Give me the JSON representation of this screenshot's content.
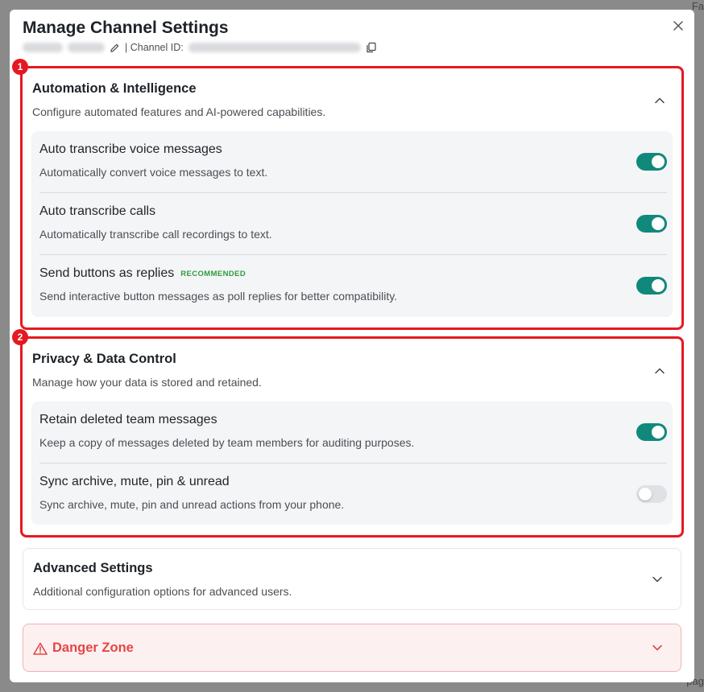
{
  "background": {
    "top_right_text": "Fa",
    "bottom_right_text": "pag"
  },
  "modal": {
    "title": "Manage Channel Settings",
    "channel_id_label": "| Channel ID:"
  },
  "markers": [
    "1",
    "2"
  ],
  "sections": {
    "automation": {
      "title": "Automation & Intelligence",
      "description": "Configure automated features and AI-powered capabilities.",
      "items": [
        {
          "title": "Auto transcribe voice messages",
          "description": "Automatically convert voice messages to text.",
          "enabled": true
        },
        {
          "title": "Auto transcribe calls",
          "description": "Automatically transcribe call recordings to text.",
          "enabled": true
        },
        {
          "title": "Send buttons as replies",
          "badge": "RECOMMENDED",
          "description": "Send interactive button messages as poll replies for better compatibility.",
          "enabled": true
        }
      ]
    },
    "privacy": {
      "title": "Privacy & Data Control",
      "description": "Manage how your data is stored and retained.",
      "items": [
        {
          "title": "Retain deleted team messages",
          "description": "Keep a copy of messages deleted by team members for auditing purposes.",
          "enabled": true
        },
        {
          "title": "Sync archive, mute, pin & unread",
          "description": "Sync archive, mute, pin and unread actions from your phone.",
          "enabled": false
        }
      ]
    },
    "advanced": {
      "title": "Advanced Settings",
      "description": "Additional configuration options for advanced users."
    },
    "danger": {
      "title": "Danger Zone"
    }
  },
  "colors": {
    "toggle_on": "#10897a",
    "toggle_off": "#dfe1e4",
    "highlight_border": "#e5191f",
    "danger_text": "#e34646",
    "badge_green": "#2f9b3e"
  }
}
